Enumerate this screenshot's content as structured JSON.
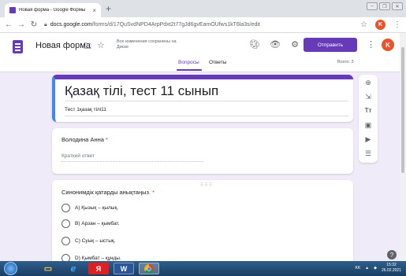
{
  "browser": {
    "tab_title": "Новая форма - Google Формы",
    "tab_close": "×",
    "new_tab": "+",
    "url_domain": "docs.google.com",
    "url_path": "/forms/d/17QuSvdNPD4ArpPdxt2t77gJd6gvEamOUfws1kT6la3s/edit",
    "window_controls": [
      "–",
      "❐",
      "✕"
    ],
    "profile_initial": "K"
  },
  "header": {
    "doc_title": "Новая форма",
    "saved_status": "Все изменения сохранены на Диске",
    "send_label": "Отправить",
    "avatar_initial": "K",
    "accent": "#673ab7"
  },
  "tabs": {
    "questions": "Вопросы",
    "answers": "Ответы",
    "total": "Всего: 3"
  },
  "form": {
    "title": "Қазақ тілі, тест 11 сынып",
    "description": "Тест 1қазақ тілі11"
  },
  "questions": [
    {
      "label": "Володина Анна",
      "required": "*",
      "placeholder": "Краткий ответ"
    },
    {
      "label": "Синонимдік қатарды анықтаңыз.",
      "required": "*",
      "drag_handle": "⠿⠿⠿",
      "options": [
        "А) Қызық – қылық.",
        "В) Арзан – қымбат.",
        "С) Суық – ыстық.",
        "D) Қымбат – құнды."
      ]
    }
  ],
  "sidebar_icons": [
    "add-question",
    "import-questions",
    "add-title",
    "add-image",
    "add-video",
    "add-section"
  ],
  "taskbar": {
    "apps": [
      "folder",
      "ie",
      "yandex",
      "word",
      "chrome"
    ],
    "yandex_label": "Я",
    "word_label": "W",
    "lang": "KK",
    "time": "15:32",
    "date": "26.02.2021"
  }
}
